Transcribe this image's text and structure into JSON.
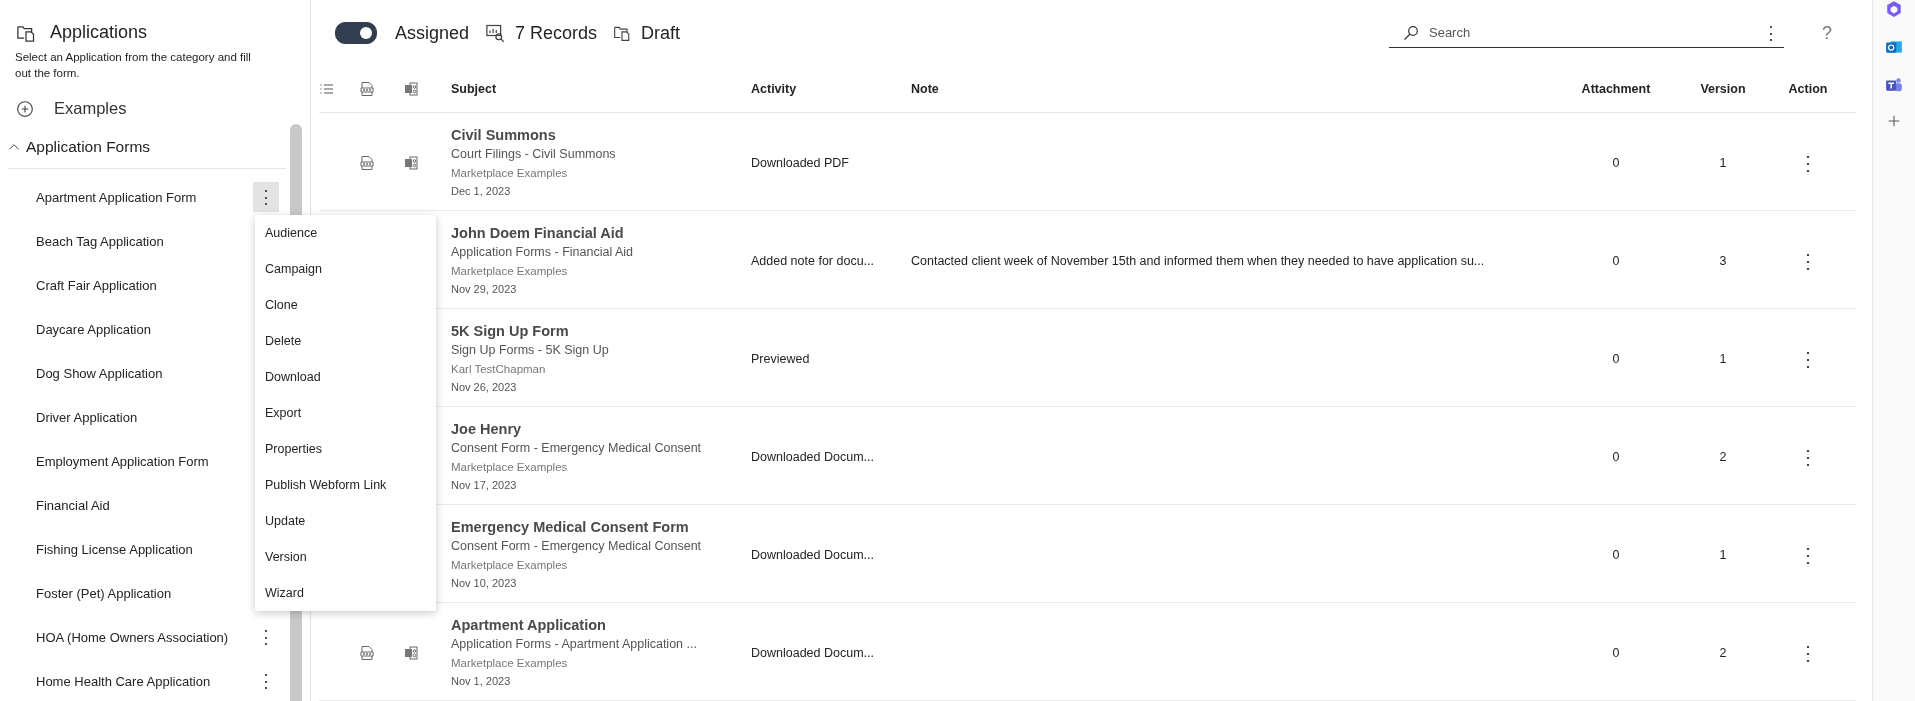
{
  "sidebar": {
    "title": "Applications",
    "description": "Select an Application from the category and fill out the form.",
    "examples": "Examples",
    "category": {
      "label": "Application Forms",
      "expanded": true,
      "items": [
        {
          "label": "Apartment Application Form",
          "actions": "⋮",
          "active": true
        },
        {
          "label": "Beach Tag Application"
        },
        {
          "label": "Craft Fair Application"
        },
        {
          "label": "Daycare Application"
        },
        {
          "label": "Dog Show Application"
        },
        {
          "label": "Driver Application"
        },
        {
          "label": "Employment Application Form"
        },
        {
          "label": "Financial Aid"
        },
        {
          "label": "Fishing License Application"
        },
        {
          "label": "Foster (Pet) Application"
        },
        {
          "label": "HOA (Home Owners Association)",
          "actions": "⋮",
          "active": false
        },
        {
          "label": "Home Health Care Application",
          "actions": "⋮",
          "active": false
        }
      ]
    }
  },
  "context_menu": [
    "Audience",
    "Campaign",
    "Clone",
    "Delete",
    "Download",
    "Export",
    "Properties",
    "Publish Webform Link",
    "Update",
    "Version",
    "Wizard"
  ],
  "toolbar": {
    "assigned": {
      "label": "Assigned",
      "on": true
    },
    "records": "7 Records",
    "draft": "Draft",
    "search": {
      "placeholder": "Search",
      "more": "⋮"
    },
    "help": "?"
  },
  "table": {
    "columns": [
      "Subject",
      "Activity",
      "Note",
      "Attachment",
      "Version",
      "Action"
    ],
    "rows": [
      {
        "file_icons": true,
        "title": "Civil Summons",
        "subtitle": "Court Filings - Civil Summons",
        "author": "Marketplace Examples",
        "date": "Dec 1, 2023",
        "activity": "Downloaded PDF",
        "attachment": "0",
        "version": "1",
        "action": "⋮"
      },
      {
        "title": "John Doem Financial Aid",
        "subtitle": "Application Forms - Financial Aid",
        "author": "Marketplace Examples",
        "date": "Nov 29, 2023",
        "activity": "Added note for docu...",
        "note": "Contacted client week of November 15th and informed them when they needed to have application su...",
        "attachment": "0",
        "version": "3",
        "action": "⋮"
      },
      {
        "title": "5K Sign Up Form",
        "subtitle": "Sign Up Forms - 5K Sign Up",
        "author": "Karl TestChapman",
        "date": "Nov 26, 2023",
        "activity": "Previewed",
        "attachment": "0",
        "version": "1",
        "action": "⋮"
      },
      {
        "title": "Joe Henry",
        "subtitle": "Consent Form - Emergency Medical Consent",
        "author": "Marketplace Examples",
        "date": "Nov 17, 2023",
        "activity": "Downloaded Docum...",
        "attachment": "0",
        "version": "2",
        "action": "⋮"
      },
      {
        "title": "Emergency Medical Consent Form",
        "subtitle": "Consent Form - Emergency Medical Consent",
        "author": "Marketplace Examples",
        "date": "Nov 10, 2023",
        "activity": "Downloaded Docum...",
        "attachment": "0",
        "version": "1",
        "action": "⋮"
      },
      {
        "file_icons": true,
        "title": "Apartment Application",
        "subtitle": "Application Forms - Apartment Application ...",
        "author": "Marketplace Examples",
        "date": "Nov 1, 2023",
        "activity": "Downloaded Docum...",
        "attachment": "0",
        "version": "2",
        "action": "⋮"
      }
    ]
  }
}
